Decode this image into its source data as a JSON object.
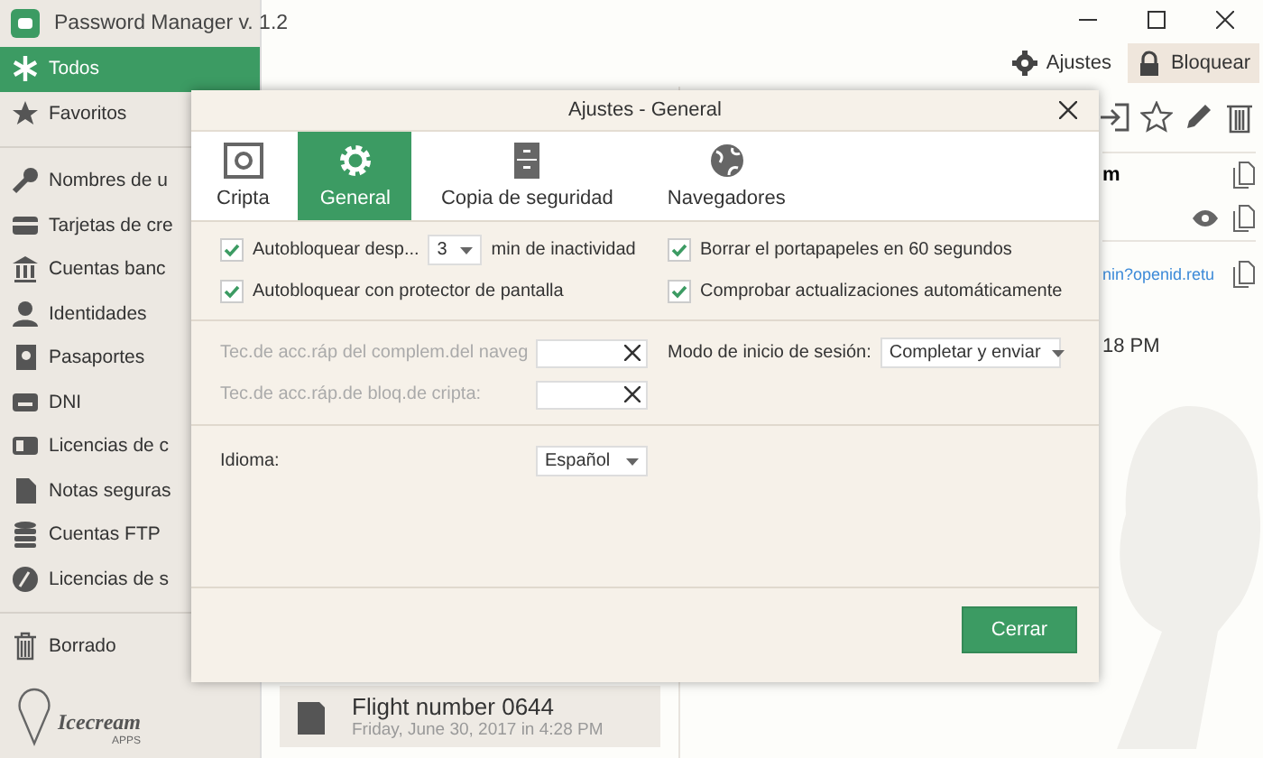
{
  "app": {
    "title": "Password Manager v. 1.2"
  },
  "sidebar": {
    "groups": [
      [
        {
          "label": "Todos",
          "selected": true
        },
        {
          "label": "Favoritos",
          "selected": false
        }
      ],
      [
        {
          "label": "Nombres de u",
          "selected": false
        },
        {
          "label": "Tarjetas de cre",
          "selected": false
        },
        {
          "label": "Cuentas banc",
          "selected": false
        },
        {
          "label": "Identidades",
          "selected": false
        },
        {
          "label": "Pasaportes",
          "selected": false
        },
        {
          "label": "DNI",
          "selected": false
        },
        {
          "label": "Licencias de c",
          "selected": false
        },
        {
          "label": "Notas seguras",
          "selected": false
        },
        {
          "label": "Cuentas FTP",
          "selected": false
        },
        {
          "label": "Licencias de s",
          "selected": false
        }
      ],
      [
        {
          "label": "Borrado",
          "selected": false
        }
      ]
    ],
    "logo": {
      "name": "Icecream",
      "sub": "APPS"
    }
  },
  "toolbar": {
    "buttons": [
      "Ajustes",
      "Bloquear"
    ]
  },
  "detail": {
    "field_value": "m",
    "link": "nin?openid.retu",
    "time": "18 PM"
  },
  "list": {
    "items": [
      {
        "title": "Flight number 0644",
        "date": "Friday, June 30, 2017 in 4:28 PM"
      }
    ]
  },
  "dialog": {
    "title": "Ajustes - General",
    "tabs": [
      {
        "label": "Cripta",
        "selected": false
      },
      {
        "label": "General",
        "selected": true
      },
      {
        "label": "Copia de seguridad",
        "selected": false
      },
      {
        "label": "Navegadores",
        "selected": false
      }
    ],
    "options_left": [
      {
        "kind": "autolock",
        "label": "Autobloquear desp...",
        "checked": true,
        "value": "3",
        "suffix": "min de inactividad"
      },
      {
        "kind": "check",
        "label": "Autobloquear con protector de pantalla",
        "checked": true
      }
    ],
    "options_right": [
      {
        "kind": "check",
        "label": "Borrar el portapapeles en 60 segundos",
        "checked": true
      },
      {
        "kind": "check",
        "label": "Comprobar actualizaciones automáticamente",
        "checked": true
      }
    ],
    "hotkeys": [
      {
        "label": "Tec.de acc.ráp del complem.del naveg",
        "disabled": true
      },
      {
        "label": "Tec.de acc.ráp.de bloq.de cripta:",
        "disabled": true
      }
    ],
    "login_mode": {
      "label": "Modo de inicio de sesión:",
      "value": "Completar y enviar"
    },
    "language": {
      "label": "Idioma:",
      "value": "Español"
    },
    "close": "Cerrar"
  }
}
